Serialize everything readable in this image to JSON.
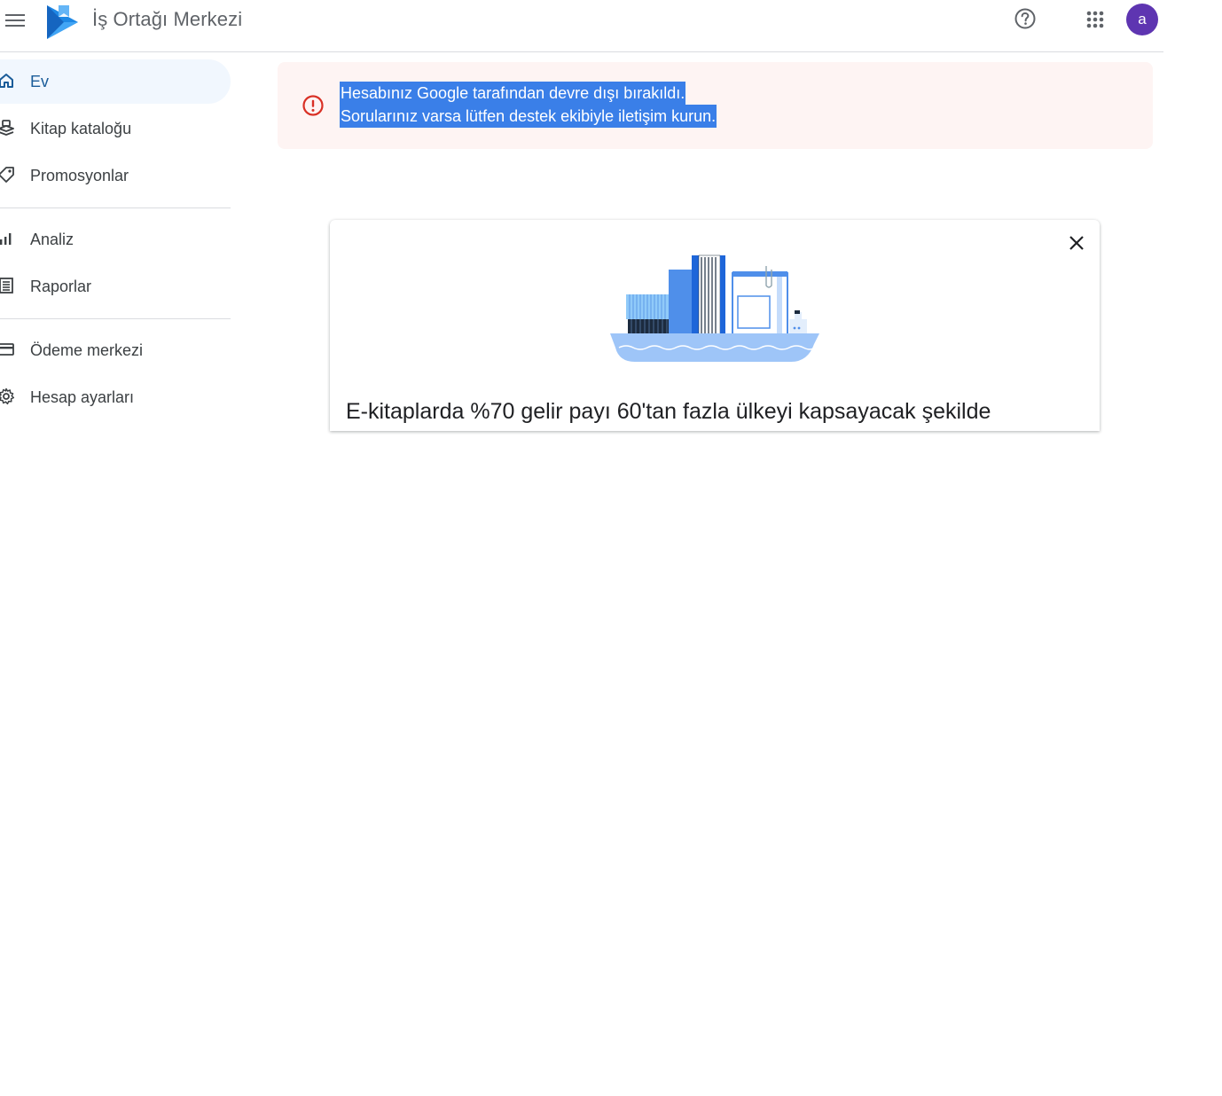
{
  "header": {
    "app_title": "İş Ortağı Merkezi",
    "avatar_initial": "a",
    "avatar_color": "#5e35b1"
  },
  "sidebar": {
    "items": [
      {
        "label": "Ev",
        "icon": "home-icon",
        "active": true
      },
      {
        "label": "Kitap kataloğu",
        "icon": "book-catalog-icon",
        "active": false
      },
      {
        "label": "Promosyonlar",
        "icon": "tag-icon",
        "active": false
      },
      {
        "label": "Analiz",
        "icon": "bar-chart-icon",
        "active": false
      },
      {
        "label": "Raporlar",
        "icon": "report-icon",
        "active": false
      },
      {
        "label": "Ödeme merkezi",
        "icon": "credit-card-icon",
        "active": false
      },
      {
        "label": "Hesap ayarları",
        "icon": "gear-icon",
        "active": false
      }
    ]
  },
  "alert": {
    "line1": "Hesabınız Google tarafından devre dışı bırakıldı.",
    "line2": "Sorularınız varsa lütfen destek ekibiyle iletişim kurun.",
    "icon": "error-icon",
    "color": "#d93025"
  },
  "card": {
    "title": "E-kitaplarda %70 gelir payı 60'tan fazla ülkeyi kapsayacak şekilde",
    "illustration": "cargo-ship-books-illustration"
  },
  "colors": {
    "accent": "#1a73e8",
    "active_nav_bg": "#f1f7fe",
    "alert_bg": "#fef4f3",
    "selection": "#3a7fe8"
  }
}
